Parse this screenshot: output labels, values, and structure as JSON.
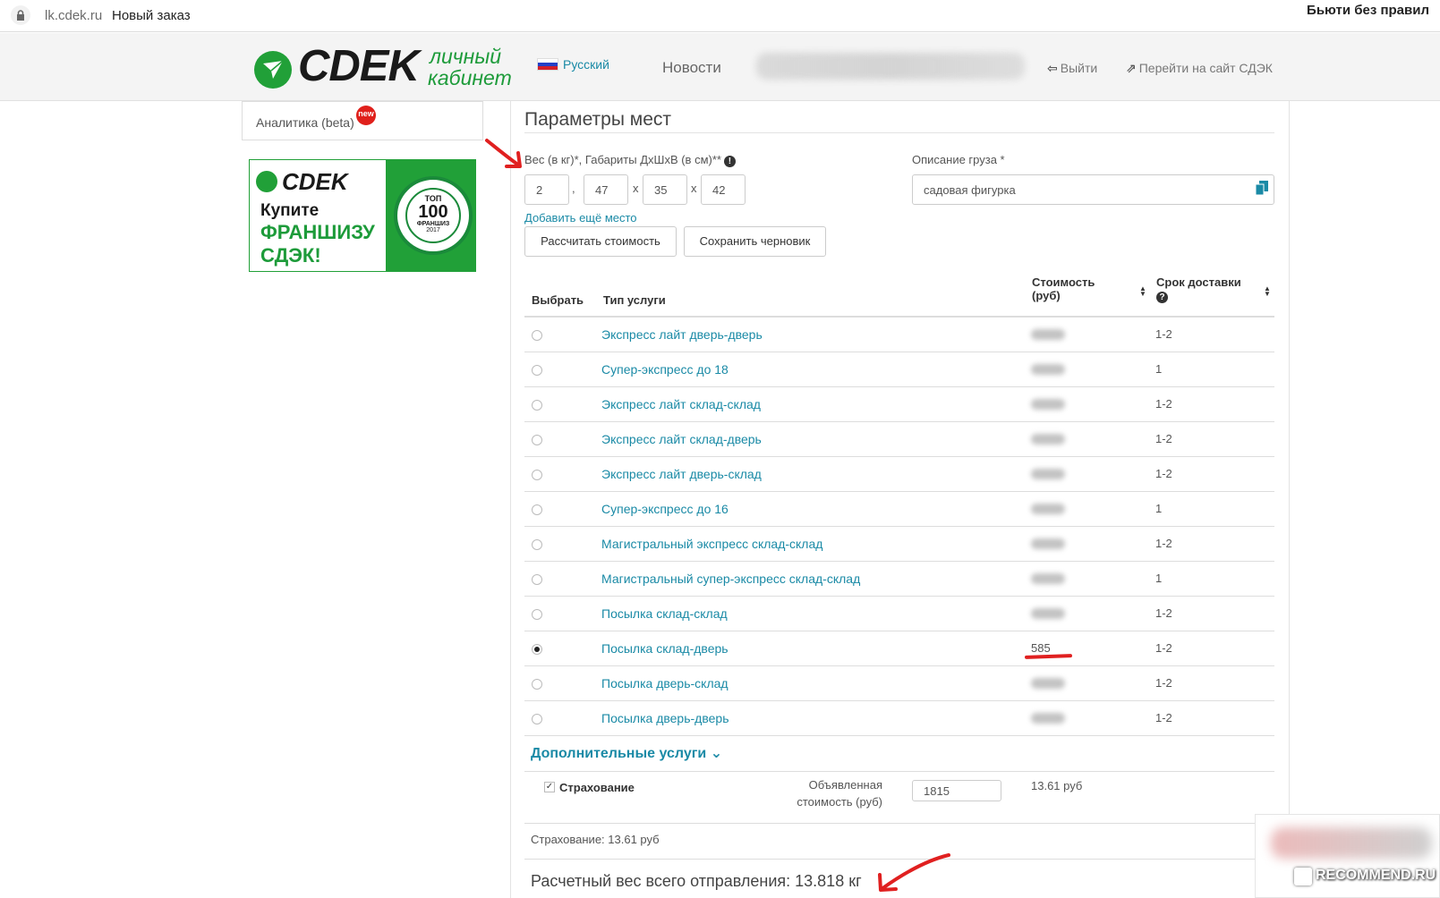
{
  "browser": {
    "url": "lk.cdek.ru",
    "page_title": "Новый заказ",
    "right_title": "Бьюти без правил"
  },
  "header": {
    "logo": "CDEK",
    "logo_sub_line1": "личный",
    "logo_sub_line2": "кабинет",
    "language": "Русский",
    "news": "Новости",
    "logout": "Выйти",
    "goto_site": "Перейти на сайт СДЭК"
  },
  "sidebar": {
    "analytics_label": "Аналитика (beta)",
    "new_badge": "new",
    "banner": {
      "logo": "CDEK",
      "line1": "Купите",
      "line2": "ФРАНШИЗУ",
      "line3": "СДЭК!",
      "seal_top": "ТОП",
      "seal_number": "100",
      "seal_label": "ФРАНШИЗ",
      "seal_year": "2017"
    }
  },
  "places": {
    "title": "Параметры мест",
    "weight_label": "Вес (в кг)*, Габариты ДхШхВ (в см)**",
    "weight": "2",
    "length": "47",
    "width": "35",
    "height": "42",
    "dot_sep": ",",
    "x_sep": "x",
    "description_label": "Описание груза *",
    "description": "садовая фигурка",
    "add_place": "Добавить ещё место",
    "calc_button": "Рассчитать стоимость",
    "save_draft_button": "Сохранить черновик"
  },
  "table": {
    "headers": {
      "select": "Выбрать",
      "service": "Тип услуги",
      "cost_line1": "Стоимость",
      "cost_line2": "(руб)",
      "delivery": "Срок доставки"
    },
    "rows": [
      {
        "service": "Экспресс лайт дверь-дверь",
        "price": "",
        "days": "1-2",
        "selected": false
      },
      {
        "service": "Супер-экспресс до 18",
        "price": "",
        "days": "1",
        "selected": false
      },
      {
        "service": "Экспресс лайт склад-склад",
        "price": "",
        "days": "1-2",
        "selected": false
      },
      {
        "service": "Экспресс лайт склад-дверь",
        "price": "",
        "days": "1-2",
        "selected": false
      },
      {
        "service": "Экспресс лайт дверь-склад",
        "price": "",
        "days": "1-2",
        "selected": false
      },
      {
        "service": "Супер-экспресс до 16",
        "price": "",
        "days": "1",
        "selected": false
      },
      {
        "service": "Магистральный экспресс склад-склад",
        "price": "",
        "days": "1-2",
        "selected": false
      },
      {
        "service": "Магистральный супер-экспресс склад-склад",
        "price": "",
        "days": "1",
        "selected": false
      },
      {
        "service": "Посылка склад-склад",
        "price": "",
        "days": "1-2",
        "selected": false
      },
      {
        "service": "Посылка склад-дверь",
        "price": "585",
        "days": "1-2",
        "selected": true
      },
      {
        "service": "Посылка дверь-склад",
        "price": "",
        "days": "1-2",
        "selected": false
      },
      {
        "service": "Посылка дверь-дверь",
        "price": "",
        "days": "1-2",
        "selected": false
      }
    ]
  },
  "extra": {
    "title": "Дополнительные услуги",
    "insurance_label": "Страхование",
    "declared_line1": "Объявленная",
    "declared_line2": "стоимость (руб)",
    "declared_value": "1815",
    "insurance_price": "13.61 руб",
    "insurance_summary": "Страхование: 13.61 руб",
    "total_weight": "Расчетный вес всего отправления: 13.818 кг"
  },
  "watermark": {
    "text": "RECOMMEND.RU"
  },
  "colors": {
    "brand_green": "#21a038",
    "link_blue": "#1a8aa6",
    "annotation_red": "#e02020"
  }
}
